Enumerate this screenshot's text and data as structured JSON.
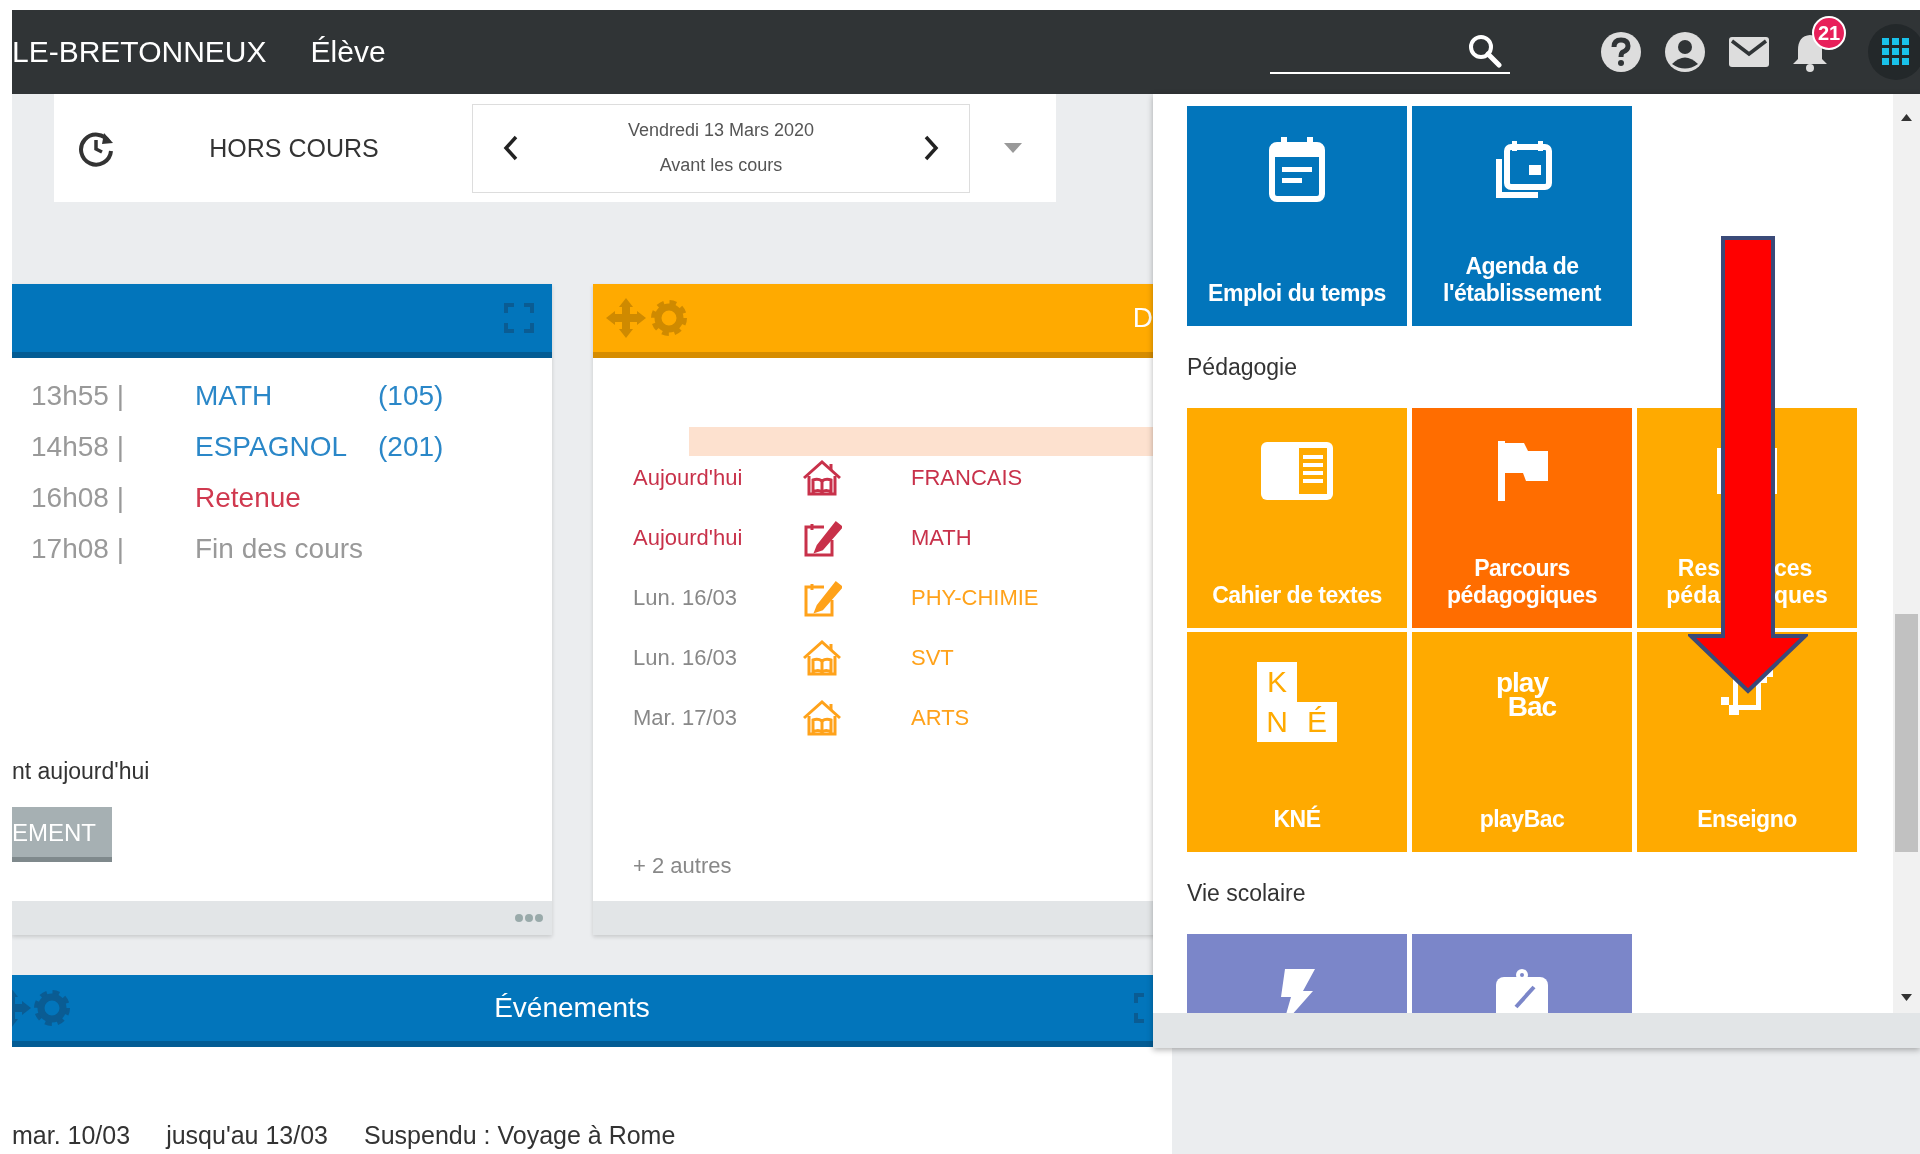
{
  "header": {
    "school": "LE-BRETONNEUX",
    "role": "Élève",
    "notifications": "21"
  },
  "status_strip": {
    "state": "HORS COURS",
    "date": "Vendredi 13 Mars 2020",
    "period": "Avant les cours"
  },
  "schedule_card": {
    "rows": [
      {
        "time": "13h55 |",
        "subject": "MATH",
        "room": "(105)",
        "kind": "course"
      },
      {
        "time": "14h58 |",
        "subject": "ESPAGNOL",
        "room": "(201)",
        "kind": "course"
      },
      {
        "time": "16h08 |",
        "subject": "Retenue",
        "kind": "detention"
      },
      {
        "time": "17h08 |",
        "subject": "Fin des cours",
        "kind": "end"
      }
    ],
    "note": "nt aujourd'hui",
    "button": "EMENT"
  },
  "homework_card": {
    "title": "D",
    "items": [
      {
        "date": "Aujourd'hui",
        "kind": "lesson",
        "subject": "FRANCAIS",
        "urgent": true
      },
      {
        "date": "Aujourd'hui",
        "kind": "exercise",
        "subject": "MATH",
        "urgent": true
      },
      {
        "date": "Lun. 16/03",
        "kind": "exercise",
        "subject": "PHY-CHIMIE",
        "urgent": false
      },
      {
        "date": "Lun. 16/03",
        "kind": "lesson",
        "subject": "SVT",
        "urgent": false
      },
      {
        "date": "Mar. 17/03",
        "kind": "lesson",
        "subject": "ARTS",
        "urgent": false
      }
    ],
    "more": "+ 2 autres"
  },
  "events_card": {
    "title": "Événements",
    "rows": [
      {
        "date": "mar. 10/03",
        "until": "jusqu'au 13/03",
        "text": "Suspendu : Voyage à Rome"
      }
    ]
  },
  "apps_menu": {
    "sections": [
      {
        "tiles": [
          {
            "label": "Emploi du temps",
            "kind": "calendar",
            "color": "#0275bb"
          },
          {
            "label": "Agenda de l'établissement",
            "kind": "agenda",
            "color": "#0275bb"
          }
        ]
      },
      {
        "title": "Pédagogie",
        "tiles": [
          {
            "label": "Cahier de textes",
            "kind": "textbook",
            "color": "#ffaa00"
          },
          {
            "label": "Parcours pédagogiques",
            "kind": "flag",
            "color": "#ff6d00"
          },
          {
            "fragments": [
              "Res",
              "ces",
              "péda",
              "ques"
            ],
            "kind": "resources",
            "color": "#ffaa00"
          },
          {
            "label": "KNÉ",
            "kind": "kne",
            "logo": [
              "K",
              "N",
              "É"
            ],
            "color": "#ffaa00"
          },
          {
            "label": "playBac",
            "kind": "playbac",
            "logo": [
              "play",
              "Bac"
            ],
            "color": "#ffaa00"
          },
          {
            "label": "Enseigno",
            "kind": "enseigno",
            "color": "#ffaa00"
          }
        ]
      },
      {
        "title": "Vie scolaire",
        "tiles": [
          {
            "kind": "lightning",
            "color": "#7b86c9"
          },
          {
            "kind": "clipboard",
            "color": "#7b86c9"
          }
        ]
      }
    ]
  }
}
